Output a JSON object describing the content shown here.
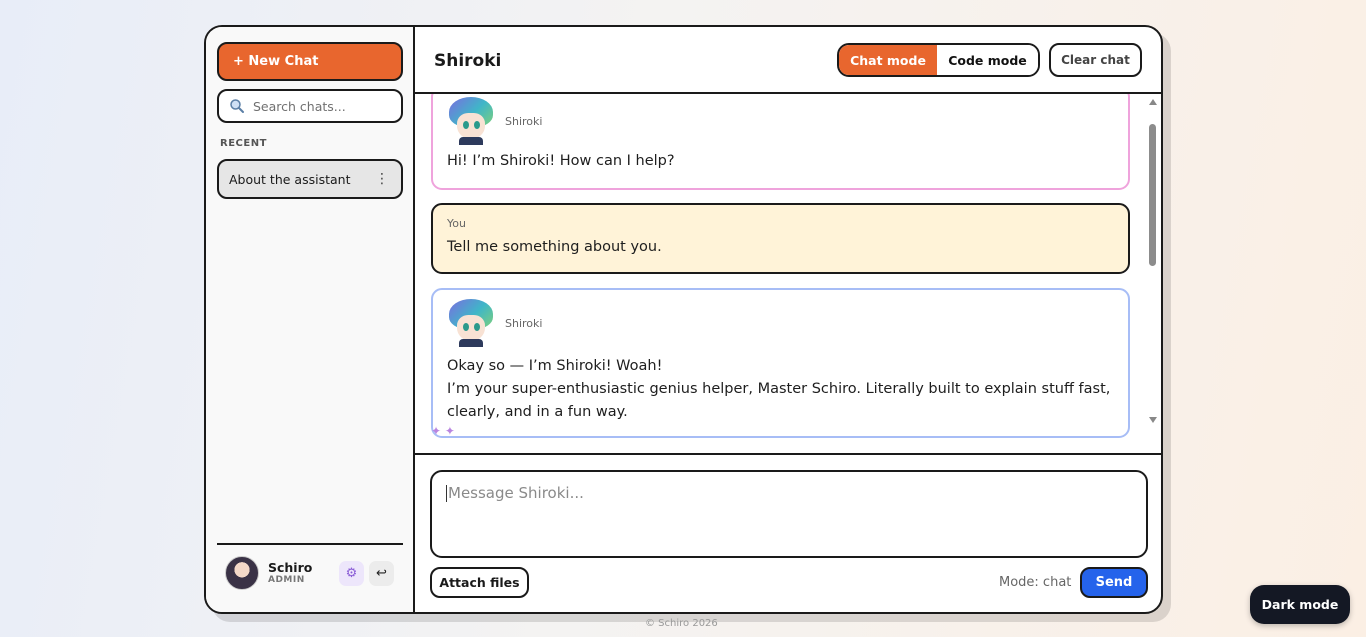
{
  "sidebar": {
    "new_chat_label": "+ New Chat",
    "search_placeholder": "Search chats...",
    "recent_label": "RECENT",
    "chats": [
      {
        "title": "About the assistant"
      }
    ],
    "user": {
      "name": "Schiro",
      "role": "ADMIN"
    }
  },
  "header": {
    "title": "Shiroki",
    "chat_mode_label": "Chat mode",
    "code_mode_label": "Code mode",
    "clear_label": "Clear chat"
  },
  "messages": [
    {
      "sender": "Shiroki",
      "text": "Hi! I’m Shiroki! How can I help?"
    },
    {
      "sender": "You",
      "text": "Tell me something about you."
    },
    {
      "sender": "Shiroki",
      "line1": "Okay so — I’m Shiroki! Woah!",
      "line2": "I’m your super-enthusiastic genius helper, Master Schiro. Literally built to explain stuff fast, clearly, and in a fun way."
    }
  ],
  "composer": {
    "placeholder": "Message Shiroki...",
    "attach_label": "Attach files",
    "mode_status": "Mode: chat",
    "send_label": "Send"
  },
  "footer": "© Schiro 2026",
  "dark_mode_label": "Dark mode",
  "colors": {
    "accent_orange": "#e8662e",
    "send_blue": "#2563eb",
    "you_bubble": "#fff3d8",
    "bot_border_pink": "#efa3dc",
    "bot_border_blue": "#a7bdf6"
  }
}
